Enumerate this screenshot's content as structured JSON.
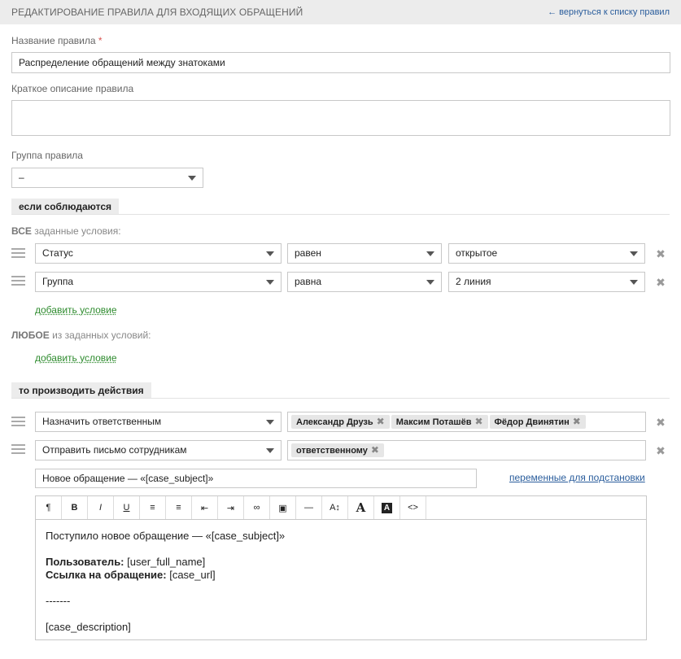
{
  "header": {
    "title": "РЕДАКТИРОВАНИЕ ПРАВИЛА ДЛЯ ВХОДЯЩИХ ОБРАЩЕНИЙ",
    "back_link": "← вернуться к списку правил"
  },
  "form": {
    "name_label": "Название правила",
    "name_required_mark": "*",
    "name_value": "Распределение обращений между знатоками",
    "description_label": "Краткое описание правила",
    "description_value": "",
    "group_label": "Группа правила",
    "group_value": "–"
  },
  "conditions": {
    "section_title": "если соблюдаются",
    "all_label_bold": "ВСЕ",
    "all_label_rest": " заданные условия:",
    "rows": [
      {
        "field": "Статус",
        "operator": "равен",
        "value": "открытое"
      },
      {
        "field": "Группа",
        "operator": "равна",
        "value": "2 линия"
      }
    ],
    "add_condition_all": "добавить условие",
    "any_label_bold": "ЛЮБОЕ",
    "any_label_rest": " из заданных условий:",
    "add_condition_any": "добавить условие"
  },
  "actions": {
    "section_title": "то производить действия",
    "rows": [
      {
        "action": "Назначить ответственным",
        "tags": [
          "Александр Друзь",
          "Максим Поташёв",
          "Фёдор Двинятин"
        ]
      },
      {
        "action": "Отправить письмо сотрудникам",
        "tags": [
          "ответственному"
        ]
      }
    ],
    "subject_value": "Новое обращение — «[case_subject]»",
    "variables_link": "переменные для подстановки",
    "toolbar": [
      {
        "name": "paragraph-icon",
        "glyph": "¶"
      },
      {
        "name": "bold-icon",
        "glyph": "B"
      },
      {
        "name": "italic-icon",
        "glyph": "I"
      },
      {
        "name": "underline-icon",
        "glyph": "U"
      },
      {
        "name": "bulleted-list-icon",
        "glyph": "≡"
      },
      {
        "name": "numbered-list-icon",
        "glyph": "≡"
      },
      {
        "name": "outdent-icon",
        "glyph": "⇤"
      },
      {
        "name": "indent-icon",
        "glyph": "⇥"
      },
      {
        "name": "link-icon",
        "glyph": "∞"
      },
      {
        "name": "image-icon",
        "glyph": "▣"
      },
      {
        "name": "horizontal-rule-icon",
        "glyph": "—"
      },
      {
        "name": "font-size-icon",
        "glyph": "A↕"
      },
      {
        "name": "font-color-icon",
        "glyph": "A"
      },
      {
        "name": "background-color-icon",
        "glyph": "A"
      },
      {
        "name": "source-code-icon",
        "glyph": "<>"
      }
    ],
    "body": {
      "line1": "Поступило новое обращение — «[case_subject]»",
      "user_label": "Пользователь:",
      "user_value": " [user_full_name]",
      "link_label": "Ссылка на обращение:",
      "link_value": " [case_url]",
      "separator": "-------",
      "description": "[case_description]"
    }
  },
  "colors": {
    "header_bg": "#ececec",
    "link_blue": "#2a5d9c",
    "link_green": "#2e8b2e",
    "required_red": "#d9534f"
  }
}
